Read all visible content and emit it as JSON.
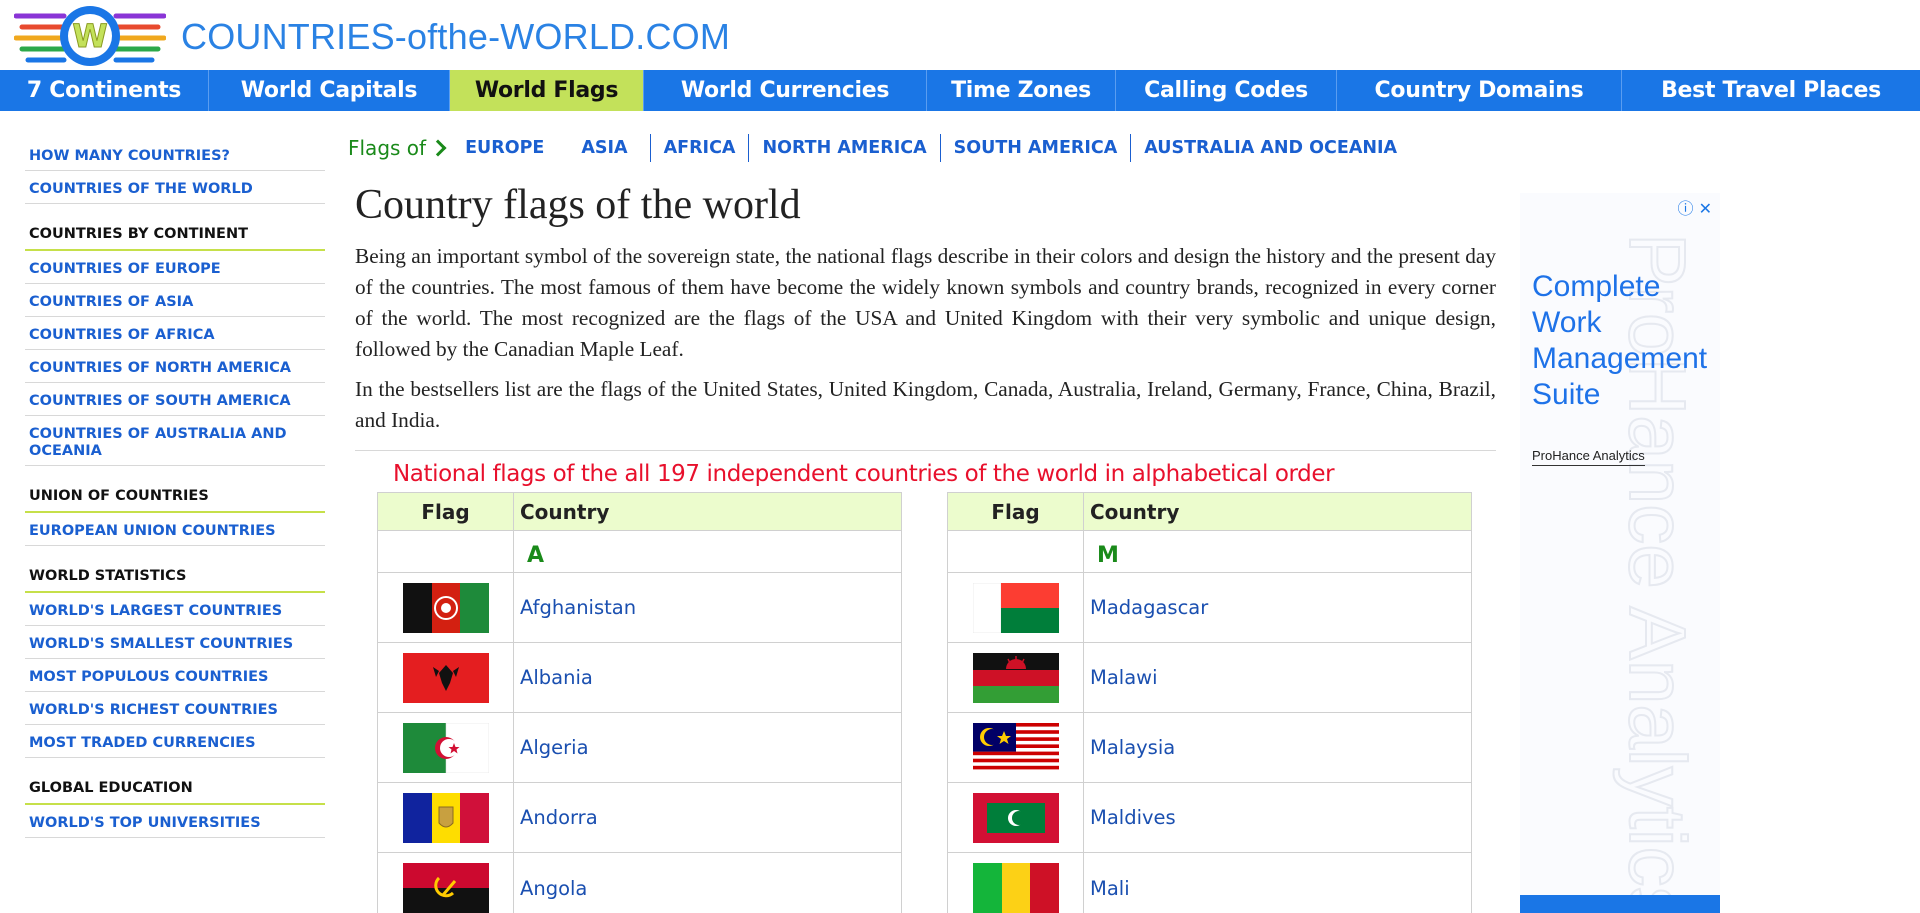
{
  "site": {
    "name": "COUNTRIES-ofthe-WORLD.COM"
  },
  "nav": {
    "items": [
      {
        "label": "7 Continents"
      },
      {
        "label": "World Capitals"
      },
      {
        "label": "World Flags"
      },
      {
        "label": "World Currencies"
      },
      {
        "label": "Time Zones"
      },
      {
        "label": "Calling Codes"
      },
      {
        "label": "Country Domains"
      },
      {
        "label": "Best Travel Places"
      }
    ]
  },
  "sidebar": {
    "how_many": "HOW MANY COUNTRIES?",
    "countries_world": "COUNTRIES OF THE WORLD",
    "by_continent_head": "COUNTRIES BY CONTINENT",
    "europe": "COUNTRIES OF EUROPE",
    "asia": "COUNTRIES OF ASIA",
    "africa": "COUNTRIES OF AFRICA",
    "north_america": "COUNTRIES OF NORTH AMERICA",
    "south_america": "COUNTRIES OF SOUTH AMERICA",
    "australia": "COUNTRIES OF AUSTRALIA AND OCEANIA",
    "union_head": "UNION OF COUNTRIES",
    "eu": "EUROPEAN UNION COUNTRIES",
    "stats_head": "WORLD STATISTICS",
    "largest": "WORLD'S LARGEST COUNTRIES",
    "smallest": "WORLD'S SMALLEST COUNTRIES",
    "populous": "MOST POPULOUS COUNTRIES",
    "richest": "WORLD'S RICHEST COUNTRIES",
    "traded": "MOST TRADED CURRENCIES",
    "education_head": "GLOBAL EDUCATION",
    "universities": "WORLD'S TOP UNIVERSITIES"
  },
  "breadcrumb": {
    "label": "Flags of",
    "continents": [
      "EUROPE",
      "ASIA",
      "AFRICA",
      "NORTH AMERICA",
      "SOUTH AMERICA",
      "AUSTRALIA AND OCEANIA"
    ]
  },
  "main": {
    "title": "Country flags of the world",
    "paragraph1": "Being an important symbol of the sovereign state, the national flags describe in their colors and design the history and the present day of the countries. The most famous of them have become the widely known symbols and country brands, recognized in every corner of the world. The most recognized are the flags of the USA and United Kingdom with their very symbolic and unique design, followed by the Canadian Maple Leaf.",
    "paragraph2": "In the bestsellers list are the flags of the United States, United Kingdom, Canada, Australia, Ireland, Germany, France, China, Brazil, and India.",
    "subtitle": "National flags of the all 197 independent countries of the world in alphabetical order"
  },
  "tables": {
    "col_flag": "Flag",
    "col_country": "Country",
    "left": {
      "letter": "A",
      "rows": [
        {
          "country": "Afghanistan",
          "flag": "afghanistan-flag-icon"
        },
        {
          "country": "Albania",
          "flag": "albania-flag-icon"
        },
        {
          "country": "Algeria",
          "flag": "algeria-flag-icon"
        },
        {
          "country": "Andorra",
          "flag": "andorra-flag-icon"
        },
        {
          "country": "Angola",
          "flag": "angola-flag-icon"
        }
      ]
    },
    "right": {
      "letter": "M",
      "rows": [
        {
          "country": "Madagascar",
          "flag": "madagascar-flag-icon"
        },
        {
          "country": "Malawi",
          "flag": "malawi-flag-icon"
        },
        {
          "country": "Malaysia",
          "flag": "malaysia-flag-icon"
        },
        {
          "country": "Maldives",
          "flag": "maldives-flag-icon"
        },
        {
          "country": "Mali",
          "flag": "mali-flag-icon"
        }
      ]
    }
  },
  "ad": {
    "headline": "Complete Work Management Suite",
    "brand": "ProHance Analytics",
    "background_text": "ProHance Analytics",
    "icons": [
      "info-icon",
      "close-icon"
    ]
  },
  "colors": {
    "brand_blue": "#1a76e6",
    "active_nav": "#c3e15a",
    "link_blue": "#1a5fd0",
    "header_green": "#ecfccd",
    "subtitle_red": "#e8102c",
    "letter_green": "#1a8a1a"
  }
}
